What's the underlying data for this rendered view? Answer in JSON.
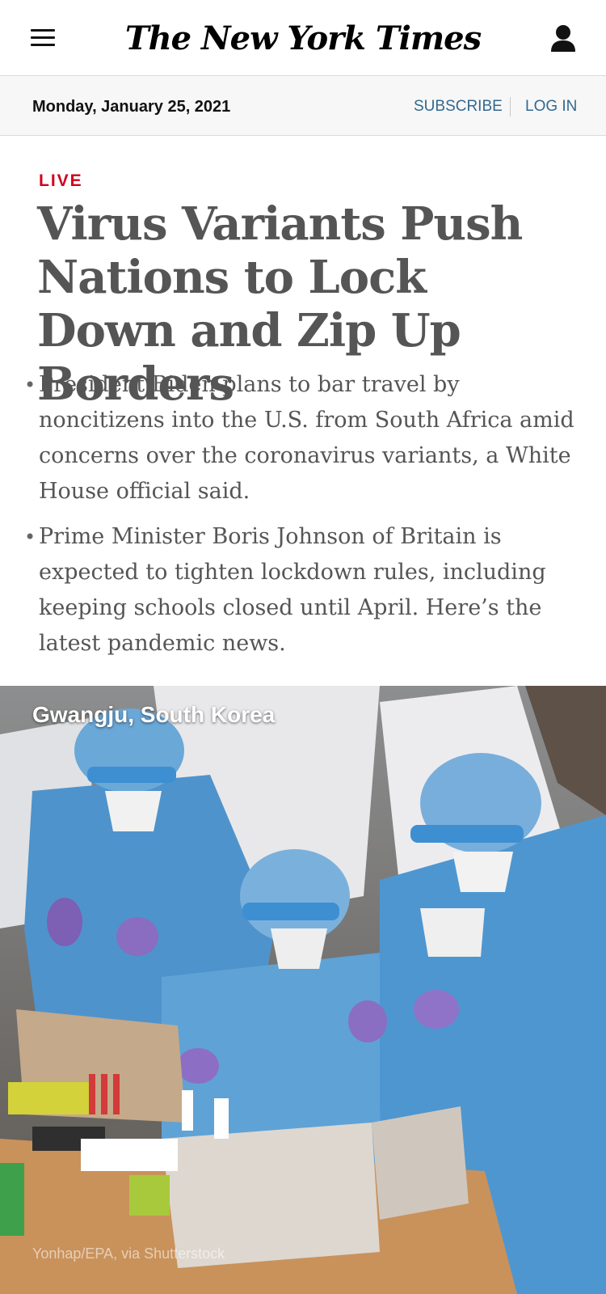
{
  "header": {
    "masthead": "The New York Times",
    "menu_icon": "hamburger-menu-icon",
    "account_icon": "user-account-icon"
  },
  "date_bar": {
    "date": "Monday, January 25, 2021",
    "subscribe": "SUBSCRIBE",
    "login": "LOG IN"
  },
  "article": {
    "live_label": "LIVE",
    "headline": "Virus Variants Push Nations to Lock Down and Zip Up Borders",
    "bullets": [
      "President Biden plans to bar travel by noncitizens into the U.S. from South Africa amid concerns over the coronavirus variants, a White House official said.",
      "Prime Minister Boris Johnson of Britain is expected to tighten lockdown rules, including keeping schools closed until April. Here’s the latest pandemic news."
    ],
    "bullet_glyph": "•"
  },
  "photo": {
    "location": "Gwangju, South Korea",
    "credit": "Yonhap/EPA, via Shutterstock"
  },
  "colors": {
    "live": "#d0021b",
    "link": "#326891",
    "headline": "#555555"
  }
}
